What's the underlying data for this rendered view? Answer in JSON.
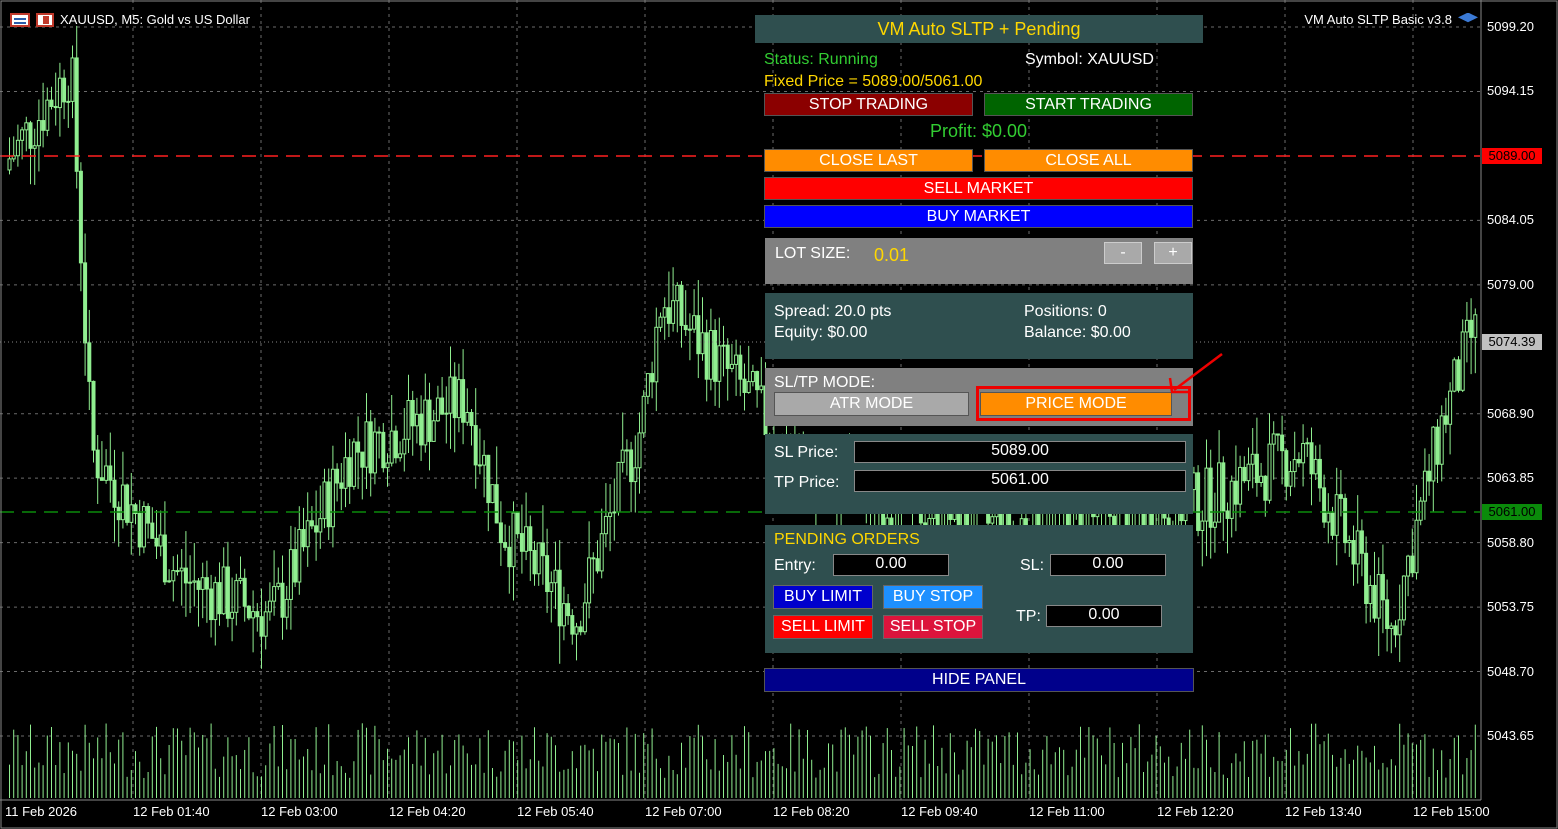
{
  "chart": {
    "symbol_title": "XAUUSD, M5:  Gold vs US Dollar",
    "ea_label": "VM Auto SLTP Basic v3.8",
    "price_axis": [
      "5099.20",
      "5094.15",
      "5084.05",
      "5079.00",
      "5068.90",
      "5063.85",
      "5058.80",
      "5053.75",
      "5048.70",
      "5043.65"
    ],
    "price_tags": {
      "sl": "5089.00",
      "current": "5074.39",
      "tp": "5061.00"
    },
    "time_axis": [
      "11 Feb 2026",
      "12 Feb 01:40",
      "12 Feb 03:00",
      "12 Feb 04:20",
      "12 Feb 05:40",
      "12 Feb 07:00",
      "12 Feb 08:20",
      "12 Feb 09:40",
      "12 Feb 11:00",
      "12 Feb 12:20",
      "12 Feb 13:40",
      "12 Feb 15:00"
    ],
    "colors": {
      "candle": "#90ee90",
      "sl_line": "#ff0000",
      "tp_line": "#008000",
      "grid": "#6b6b6b"
    }
  },
  "panel": {
    "title": "VM Auto SLTP + Pending",
    "status": "Status: Running",
    "symbol": "Symbol: XAUUSD",
    "fixed_price": "Fixed Price = 5089.00/5061.00",
    "stop_trading": "STOP TRADING",
    "start_trading": "START TRADING",
    "profit": "Profit: $0.00",
    "close_last": "CLOSE LAST",
    "close_all": "CLOSE ALL",
    "sell_market": "SELL MARKET",
    "buy_market": "BUY MARKET",
    "lot_label": "LOT SIZE:",
    "lot_value": "0.01",
    "lot_minus": "-",
    "lot_plus": "+",
    "spread": "Spread: 20.0 pts",
    "positions": "Positions: 0",
    "equity": "Equity: $0.00",
    "balance": "Balance: $0.00",
    "mode_label": "SL/TP MODE:",
    "atr_mode": "ATR MODE",
    "price_mode": "PRICE MODE",
    "sl_price_label": "SL Price:",
    "sl_price_value": "5089.00",
    "tp_price_label": "TP Price:",
    "tp_price_value": "5061.00",
    "pending_title": "PENDING ORDERS",
    "entry_label": "Entry:",
    "entry_value": "0.00",
    "pending_sl_label": "SL:",
    "pending_sl_value": "0.00",
    "pending_tp_label": "TP:",
    "pending_tp_value": "0.00",
    "buy_limit": "BUY LIMIT",
    "buy_stop": "BUY STOP",
    "sell_limit": "SELL LIMIT",
    "sell_stop": "SELL STOP",
    "hide_panel": "HIDE PANEL"
  }
}
